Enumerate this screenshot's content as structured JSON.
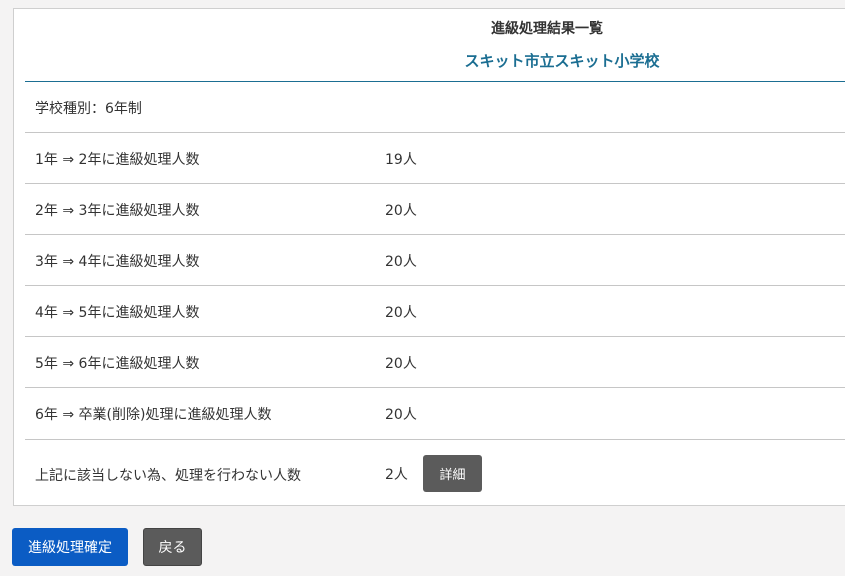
{
  "header": {
    "title": "進級処理結果一覧",
    "school_name": "スキット市立スキット小学校"
  },
  "school_type": "学校種別：6年制",
  "rows": [
    {
      "label": "1年 ⇒ 2年に進級処理人数",
      "value": "19人"
    },
    {
      "label": "2年 ⇒ 3年に進級処理人数",
      "value": "20人"
    },
    {
      "label": "3年 ⇒ 4年に進級処理人数",
      "value": "20人"
    },
    {
      "label": "4年 ⇒ 5年に進級処理人数",
      "value": "20人"
    },
    {
      "label": "5年 ⇒ 6年に進級処理人数",
      "value": "20人"
    },
    {
      "label": "6年 ⇒ 卒業(削除)処理に進級処理人数",
      "value": "20人"
    },
    {
      "label": "上記に該当しない為、処理を行わない人数",
      "value": "2人",
      "button": "詳細"
    }
  ],
  "actions": {
    "confirm_label": "進級処理確定",
    "back_label": "戻る"
  },
  "colors": {
    "accent": "#1b6e92",
    "primary_button": "#0b5cc4",
    "secondary_button": "#5b5b5b"
  }
}
